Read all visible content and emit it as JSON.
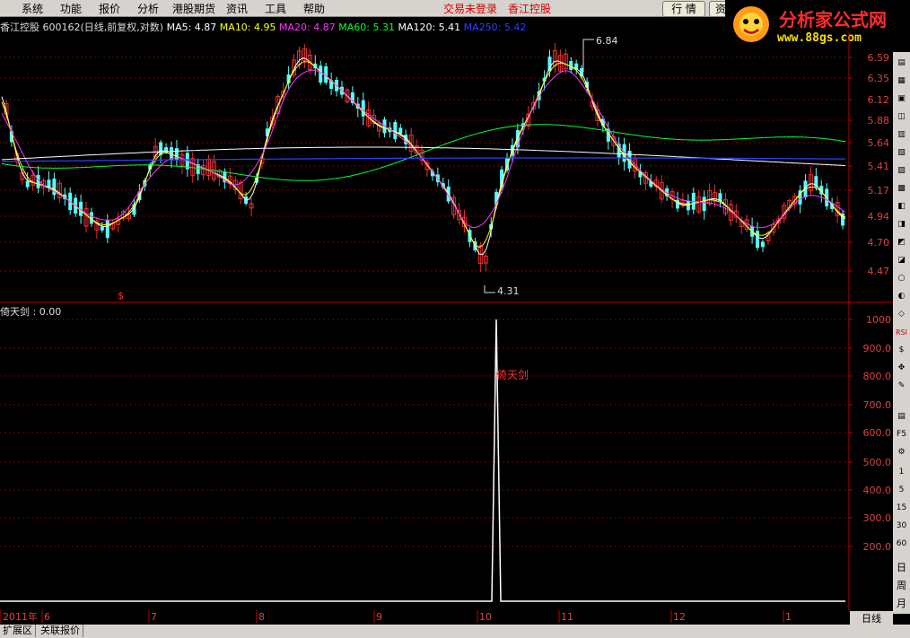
{
  "menubar": {
    "items": [
      "系统",
      "功能",
      "报价",
      "分析",
      "港股期货",
      "资讯",
      "工具",
      "帮助"
    ],
    "login_status": "交易未登录",
    "stock_name": "香江控股",
    "btn_quote": "行 情",
    "btn_info": "资"
  },
  "brand": {
    "title": "分析家公式网",
    "url": "www.88gs.com"
  },
  "main_chart": {
    "header": {
      "symbol": "香江控股",
      "code_info": "600162(日线,前复权,对数)",
      "ma5": "MA5: 4.87",
      "ma10": "MA10: 4.95",
      "ma20": "MA20: 4.87",
      "ma60": "MA60: 5.31",
      "ma120": "MA120: 5.41",
      "ma250": "MA250: 5.42"
    },
    "price_ticks": [
      "6.59",
      "6.35",
      "6.12",
      "5.88",
      "5.64",
      "5.41",
      "5.17",
      "4.94",
      "4.70",
      "4.47"
    ],
    "high_label": "6.84",
    "low_label": "4.31",
    "signal_marker": "$"
  },
  "indicator": {
    "header": "倚天剑 : 0.00",
    "signal_label": "倚天剑",
    "ticks": [
      "1000",
      "900.0",
      "800.0",
      "700.0",
      "600.0",
      "500.0",
      "400.0",
      "300.0",
      "200.0"
    ]
  },
  "time_axis": {
    "labels": [
      "2011年",
      "6",
      "7",
      "8",
      "9",
      "10",
      "11",
      "12",
      "1"
    ],
    "period": "日线"
  },
  "side_toolbar": [
    "RSI",
    "F5",
    "1",
    "5",
    "15",
    "30",
    "60",
    "日",
    "周",
    "月"
  ],
  "tabs": [
    "扩展区",
    "关联报价"
  ],
  "colors": {
    "up": "#e83030",
    "down": "#55ffff",
    "ma5": "#ffffff",
    "ma10": "#ffff00",
    "ma20": "#ff33ff",
    "ma60": "#00ff33",
    "ma120": "#ffffff",
    "ma250": "#3040ff",
    "axis": "#c00000",
    "grid": "#7a0000"
  }
}
